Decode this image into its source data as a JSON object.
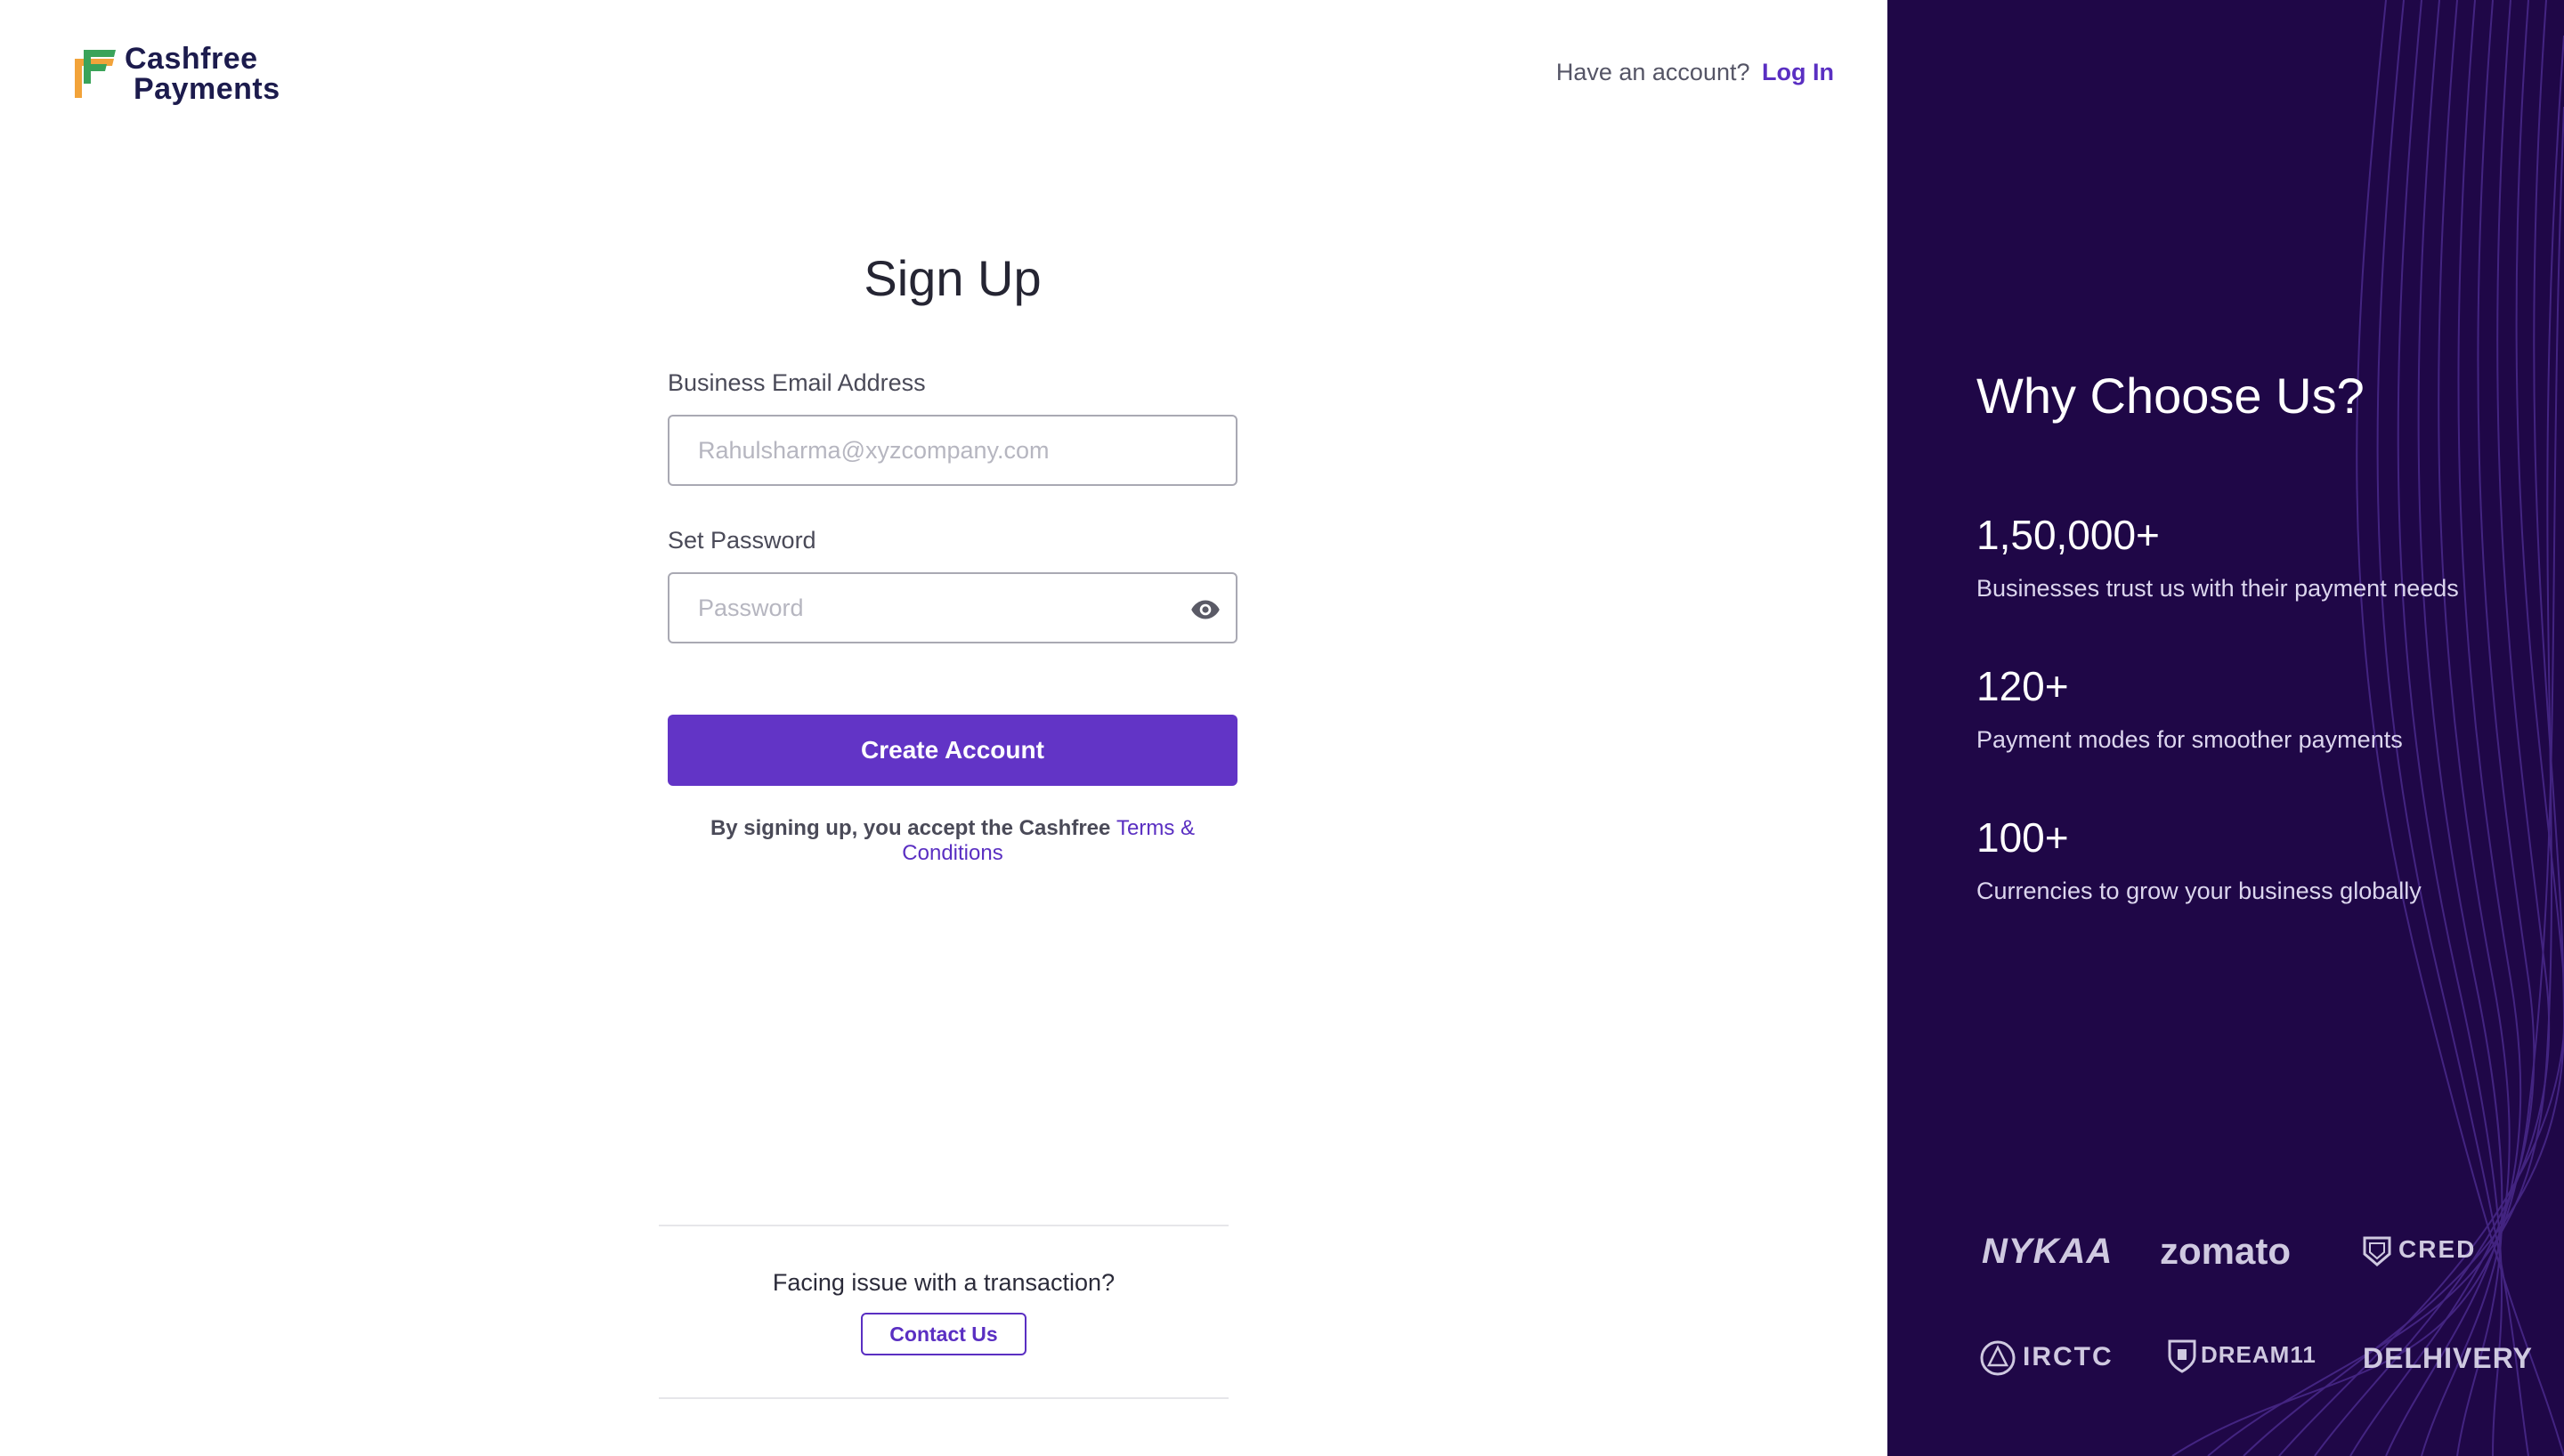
{
  "header": {
    "logo_line1": "Cashfree",
    "logo_line2": "Payments",
    "have_account_text": "Have an account?",
    "login_link": "Log In"
  },
  "form": {
    "title": "Sign Up",
    "email_label": "Business Email Address",
    "email_placeholder": "Rahulsharma@xyzcompany.com",
    "email_value": "",
    "password_label": "Set Password",
    "password_placeholder": "Password",
    "password_value": "",
    "submit_label": "Create Account",
    "terms_prefix": "By signing up, you accept the Cashfree",
    "terms_link": "Terms & Conditions"
  },
  "support": {
    "question": "Facing issue with a transaction?",
    "contact_label": "Contact Us"
  },
  "sidebar": {
    "heading": "Why Choose Us?",
    "stats": [
      {
        "value": "1,50,000+",
        "description": "Businesses trust us with their payment needs"
      },
      {
        "value": "120+",
        "description": "Payment modes for smoother payments"
      },
      {
        "value": "100+",
        "description": "Currencies to grow your business globally"
      }
    ],
    "brands": [
      "NYKAA",
      "zomato",
      "CRED",
      "IRCTC",
      "DREAM11",
      "DELHIVERY"
    ]
  },
  "colors": {
    "primary": "#6234c6",
    "sidebar_bg": "#1f0747",
    "link": "#5a2fc2"
  }
}
